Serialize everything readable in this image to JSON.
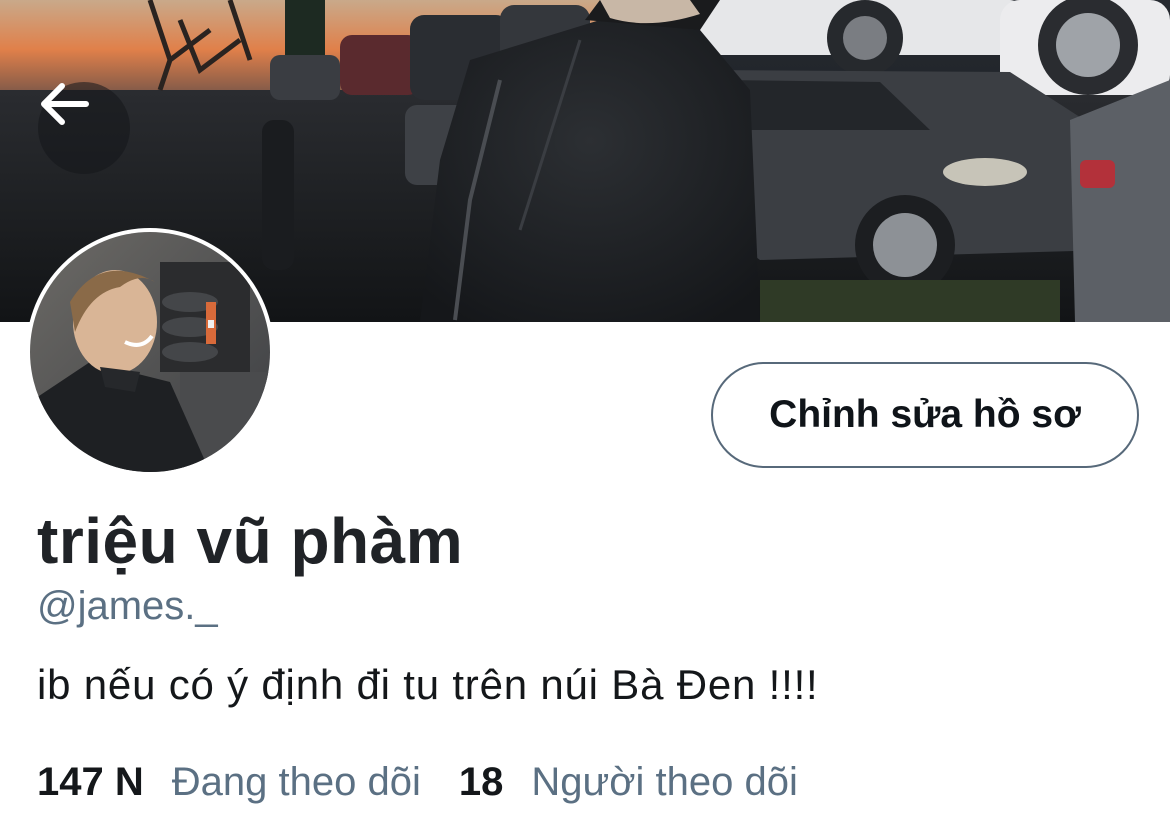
{
  "profile": {
    "display_name": "triệu vũ phàm",
    "handle": "@james._",
    "bio": "ib nếu có ý định đi tu trên núi Bà Đen !!!!",
    "edit_button_label": "Chỉnh sửa hồ sơ"
  },
  "stats": {
    "following_count": "147 N",
    "following_label": "Đang theo dõi",
    "followers_count": "18",
    "followers_label": "Người theo dõi"
  },
  "icons": {
    "back": "arrow-left-icon"
  },
  "colors": {
    "name_text": "#202327",
    "muted_text": "#5b7083",
    "button_border": "#57697a",
    "background": "#ffffff"
  }
}
